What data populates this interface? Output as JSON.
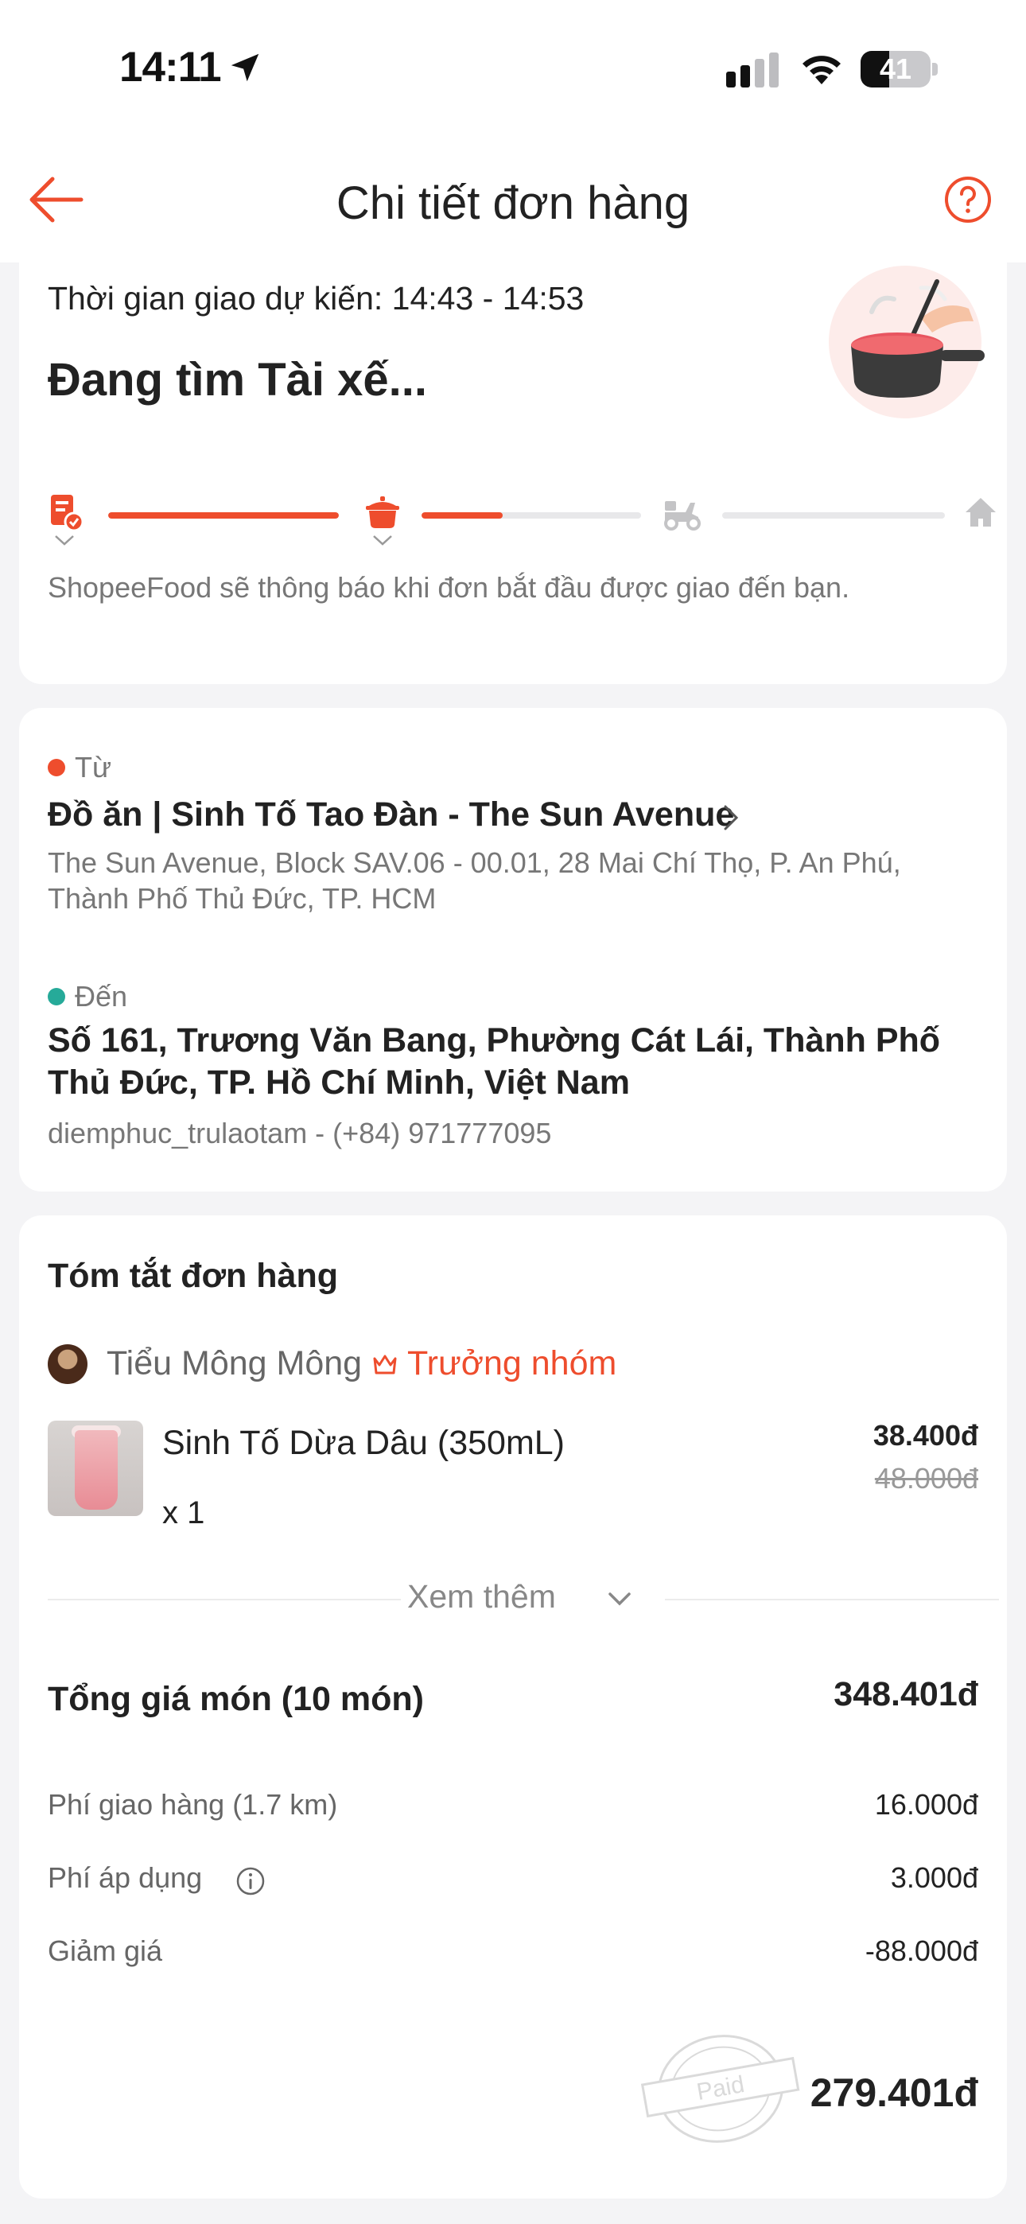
{
  "status_bar": {
    "time": "14:11",
    "battery": "41",
    "battery_level": 0.41,
    "icons": [
      "location-arrow-icon",
      "cellular-signal-icon",
      "wifi-icon",
      "battery-icon"
    ]
  },
  "nav": {
    "title": "Chi tiết đơn hàng",
    "back_icon": "back-arrow-icon",
    "help_icon": "help-circle-icon"
  },
  "status_card": {
    "eta": "Thời gian giao dự kiến: 14:43 - 14:53",
    "title": "Đang tìm Tài xế...",
    "progress": {
      "steps": [
        "order-confirmed-icon",
        "cooking-pot-icon",
        "scooter-icon",
        "home-icon"
      ],
      "segments": [
        1.0,
        0.37,
        0.0
      ]
    },
    "notice": "ShopeeFood sẽ thông báo khi đơn bắt đầu được giao đến bạn."
  },
  "address_card": {
    "from_label": "Từ",
    "from_name": "Đồ ăn | Sinh Tố Tao Đàn - The Sun Avenue",
    "from_address": "The Sun Avenue, Block SAV.06 - 00.01, 28 Mai Chí Thọ, P. An Phú, Thành Phố Thủ Đức, TP. HCM",
    "to_label": "Đến",
    "to_address": "Số 161, Trương Văn Bang, Phường Cát Lái, Thành Phố Thủ Đức, TP. Hồ Chí Minh, Việt Nam",
    "to_contact": "diemphuc_trulaotam - (+84) 971777095"
  },
  "summary": {
    "title": "Tóm tắt đơn hàng",
    "user_name": "Tiểu Mông Mông",
    "leader_label": "Trưởng nhóm",
    "items": [
      {
        "name": "Sinh Tố Dừa Dâu (350mL)",
        "qty": "x 1",
        "price": "38.400đ",
        "old_price": "48.000đ"
      }
    ],
    "see_more": "Xem thêm",
    "subtotal_label": "Tổng giá món (10 món)",
    "subtotal_value": "348.401đ",
    "fees": [
      {
        "label": "Phí giao hàng (1.7 km)",
        "value": "16.000đ"
      },
      {
        "label": "Phí áp dụng",
        "value": "3.000đ"
      },
      {
        "label": "Giảm giá",
        "value": "-88.000đ"
      }
    ],
    "stamp_text": "Paid",
    "total": "279.401đ"
  },
  "colors": {
    "accent": "#ee4d2d",
    "to_dot": "#26aa99",
    "background": "#f4f4f6",
    "text_primary": "#222222",
    "text_secondary": "#777777"
  }
}
